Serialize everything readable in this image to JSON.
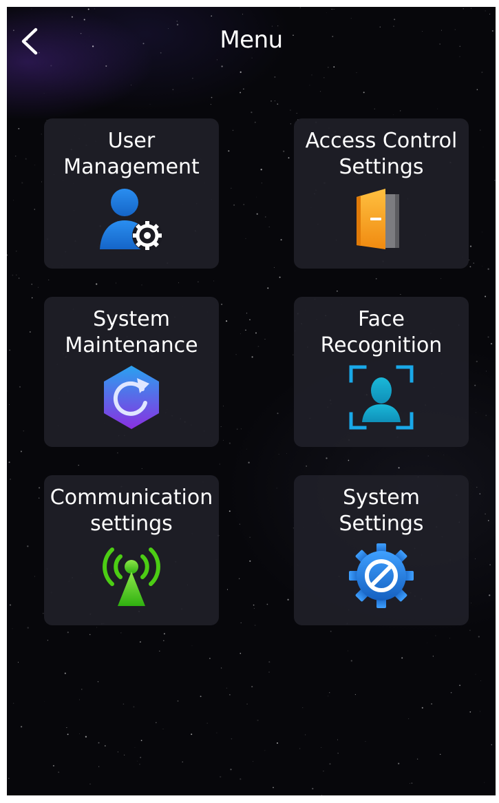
{
  "header": {
    "title": "Menu",
    "back_icon": "chevron-left-icon"
  },
  "menu": {
    "tiles": [
      {
        "line1": "User",
        "line2": "Management",
        "icon": "user-gear-icon"
      },
      {
        "line1": "Access Control",
        "line2": "Settings",
        "icon": "door-icon"
      },
      {
        "line1": "System",
        "line2": "Maintenance",
        "icon": "refresh-hexagon-icon"
      },
      {
        "line1": "Face",
        "line2": "Recognition",
        "icon": "face-scan-icon"
      },
      {
        "line1": "Communication",
        "line2": "settings",
        "icon": "antenna-signal-icon"
      },
      {
        "line1": "System",
        "line2": "Settings",
        "icon": "settings-gear-icon"
      }
    ]
  },
  "colors": {
    "background": "#07070b",
    "tile": "#202028",
    "text": "#ffffff",
    "user_blue": "#1a7fe0",
    "door_orange": "#f5a020",
    "hex_blue": "#2f7ae6",
    "hex_purple": "#7a3be0",
    "face_cyan": "#19a8e0",
    "signal_green": "#5ad419",
    "gear_blue": "#1e7fd8"
  }
}
